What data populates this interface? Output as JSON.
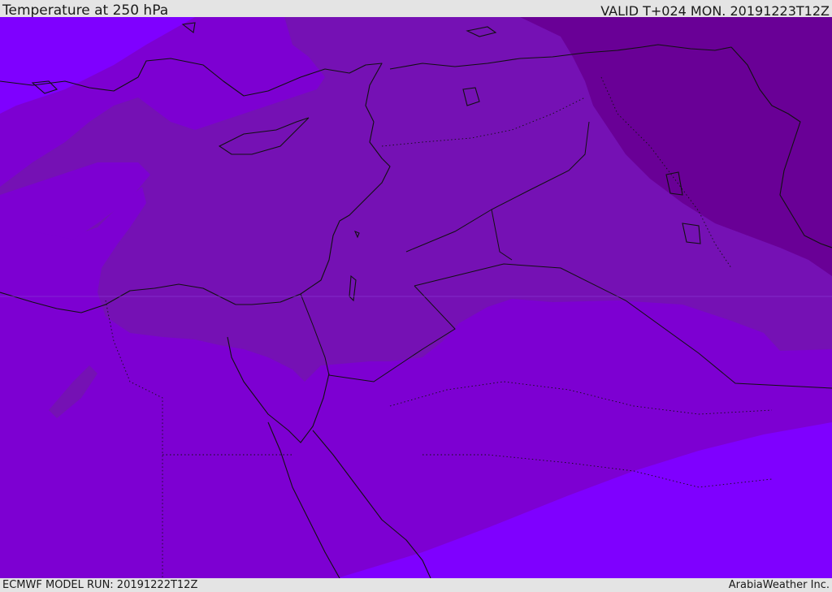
{
  "header": {
    "title": "Temperature at 250 hPa",
    "valid_time": "VALID T+024 MON. 20191223T12Z"
  },
  "footer": {
    "model_run": "ECMWF MODEL RUN: 20191222T12Z",
    "credit": "ArabiaWeather Inc."
  },
  "map": {
    "parameter": "temperature",
    "level": "250 hPa",
    "colors": {
      "coldest": "#690096",
      "cold": "#7511b4",
      "mid": "#7d00d2",
      "warm": "#7f00ff",
      "coastline": "#111111"
    }
  }
}
